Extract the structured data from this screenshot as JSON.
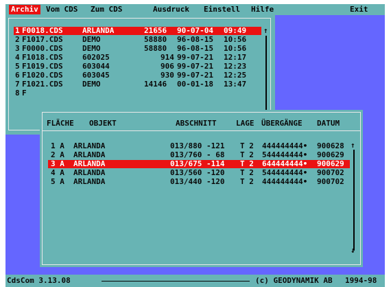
{
  "menu": {
    "items": [
      "Archiv",
      "Vom CDS",
      "Zum CDS",
      "Ausdruck",
      "Einstell",
      "Hilfe",
      "Exit"
    ]
  },
  "files": {
    "rows": [
      {
        "index": "1",
        "file": "F0018.CDS",
        "name": "ARLANDA",
        "size": "21656",
        "date": "90-07-04",
        "time": "09:49"
      },
      {
        "index": "2",
        "file": "F1017.CDS",
        "name": "DEMO",
        "size": "58880",
        "date": "96-08-15",
        "time": "10:56"
      },
      {
        "index": "3",
        "file": "F0000.CDS",
        "name": "DEMO",
        "size": "58880",
        "date": "96-08-15",
        "time": "10:56"
      },
      {
        "index": "4",
        "file": "F1018.CDS",
        "name": "602025",
        "size": "914",
        "date": "99-07-21",
        "time": "12:17"
      },
      {
        "index": "5",
        "file": "F1019.CDS",
        "name": "603044",
        "size": "906",
        "date": "99-07-21",
        "time": "12:23"
      },
      {
        "index": "6",
        "file": "F1020.CDS",
        "name": "603045",
        "size": "930",
        "date": "99-07-21",
        "time": "12:25"
      },
      {
        "index": "7",
        "file": "F1021.CDS",
        "name": "DEMO",
        "size": "14146",
        "date": "00-01-18",
        "time": "13:47"
      },
      {
        "index": "8",
        "file": "F",
        "name": "",
        "size": "",
        "date": "",
        "time": ""
      }
    ],
    "selected_index": 0
  },
  "records": {
    "headers": [
      "FLÄCHE",
      "OBJEKT",
      "ABSCHNITT",
      "LAGE",
      "ÜBERGÄNGE",
      "DATUM"
    ],
    "rows": [
      {
        "flache": "1 A",
        "objekt": "ARLANDA",
        "abschnitt": "013/880 -121",
        "lage": "T 2",
        "uebergange": "444444444•",
        "datum": "900628"
      },
      {
        "flache": "2 A",
        "objekt": "ARLANDA",
        "abschnitt": "013/760 - 68",
        "lage": "T 2",
        "uebergange": "544444444•",
        "datum": "900629"
      },
      {
        "flache": "3 A",
        "objekt": "ARLANDA",
        "abschnitt": "013/675 -114",
        "lage": "T 2",
        "uebergange": "644444444•",
        "datum": "900629"
      },
      {
        "flache": "4 A",
        "objekt": "ARLANDA",
        "abschnitt": "013/560 -120",
        "lage": "T 2",
        "uebergange": "544444444•",
        "datum": "900702"
      },
      {
        "flache": "5 A",
        "objekt": "ARLANDA",
        "abschnitt": "013/440 -120",
        "lage": "T 2",
        "uebergange": "444444444•",
        "datum": "900702"
      }
    ],
    "selected_index": 2
  },
  "status": {
    "version": "CdsCom 3.13.08",
    "copyright": "(c) GEODYNAMIK AB",
    "years": "1994-98"
  },
  "colors": {
    "panel": "#68b4b4",
    "desktop": "#6566ff",
    "selection": "#ea1212",
    "border": "#e9e9e9"
  }
}
